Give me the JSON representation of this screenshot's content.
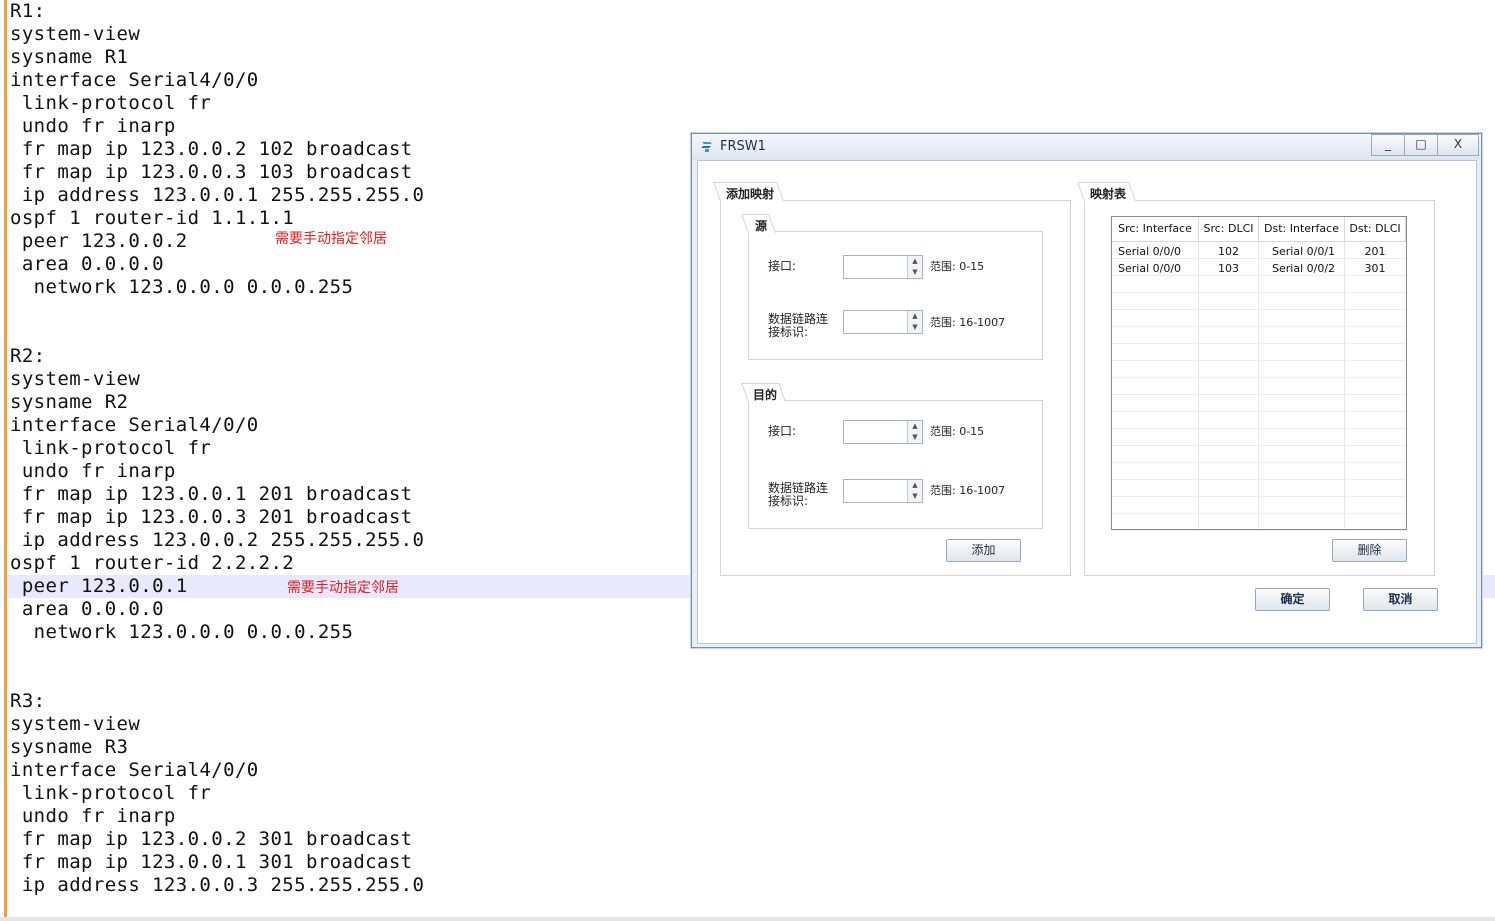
{
  "code_lines": [
    "R1:",
    "system-view",
    "sysname R1",
    "interface Serial4/0/0",
    " link-protocol fr",
    " undo fr inarp",
    " fr map ip 123.0.0.2 102 broadcast",
    " fr map ip 123.0.0.3 103 broadcast",
    " ip address 123.0.0.1 255.255.255.0",
    "ospf 1 router-id 1.1.1.1",
    " peer 123.0.0.2",
    " area 0.0.0.0",
    "  network 123.0.0.0 0.0.0.255",
    "",
    "",
    "R2:",
    "system-view",
    "sysname R2",
    "interface Serial4/0/0",
    " link-protocol fr",
    " undo fr inarp",
    " fr map ip 123.0.0.1 201 broadcast",
    " fr map ip 123.0.0.3 201 broadcast",
    " ip address 123.0.0.2 255.255.255.0",
    "ospf 1 router-id 2.2.2.2",
    " peer 123.0.0.1",
    " area 0.0.0.0",
    "  network 123.0.0.0 0.0.0.255",
    "",
    "",
    "R3:",
    "system-view",
    "sysname R3",
    "interface Serial4/0/0",
    " link-protocol fr",
    " undo fr inarp",
    " fr map ip 123.0.0.2 301 broadcast",
    " fr map ip 123.0.0.1 301 broadcast",
    " ip address 123.0.0.3 255.255.255.0"
  ],
  "notes": {
    "r1_peer_note": "需要手动指定邻居",
    "r2_peer_note": "需要手动指定邻居"
  },
  "dialog": {
    "title": "FRSW1",
    "minimize": "_",
    "maximize": "□",
    "close": "X",
    "add_group_title": "添加映射",
    "source_title": "源",
    "dest_title": "目的",
    "interface_label": "接口:",
    "dlci_label_line1": "数据链路连",
    "dlci_label_line2": "接标识:",
    "interface_range": "范围: 0-15",
    "dlci_range": "范围: 16-1007",
    "add_button": "添加",
    "map_table_title": "映射表",
    "delete_button": "删除",
    "ok_button": "确定",
    "cancel_button": "取消",
    "table_headers": [
      "Src: Interface",
      "Src: DLCI",
      "Dst: Interface",
      "Dst: DLCI"
    ],
    "table_rows": [
      [
        "Serial 0/0/0",
        "102",
        "Serial 0/0/1",
        "201"
      ],
      [
        "Serial 0/0/0",
        "103",
        "Serial 0/0/2",
        "301"
      ]
    ]
  }
}
